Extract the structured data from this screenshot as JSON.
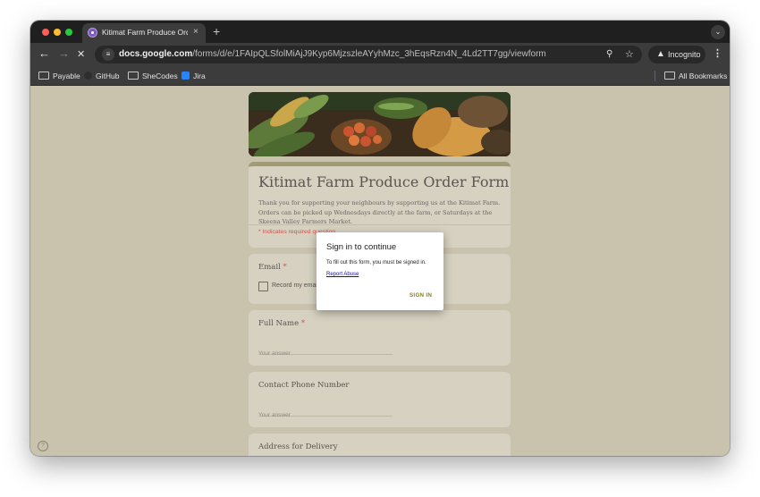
{
  "browser": {
    "tab": {
      "title": "Kitimat Farm Produce Order Form",
      "close_glyph": "×"
    },
    "new_tab_glyph": "+",
    "toolbar": {
      "back_glyph": "←",
      "forward_glyph": "→",
      "stop_glyph": "✕",
      "url_host": "docs.google.com",
      "url_path": "/forms/d/e/1FAIpQLSfolMiAjJ9Kyp6MjzszleAYyhMzc_3hEqsRzn4N_4Ld2TT7gg/viewform",
      "incognito_label": "Incognito"
    },
    "bookmarks": {
      "items": [
        "Payable",
        "GitHub",
        "SheCodes",
        "Jira"
      ],
      "all_bookmarks": "All Bookmarks"
    }
  },
  "form": {
    "title": "Kitimat Farm Produce Order Form",
    "description": "Thank you for supporting your neighbours by supporting us at the Kitimat Farm. Orders can be picked up Wednesdays directly at the farm, or Saturdays at the Skeena Valley Farmers Market.",
    "required_note": "* Indicates required question",
    "email": {
      "label": "Email",
      "required_mark": "*",
      "checkbox_label": "Record my email address with my response"
    },
    "questions": [
      {
        "label": "Full Name",
        "required_mark": "*",
        "placeholder": "Your answer"
      },
      {
        "label": "Contact Phone Number",
        "required_mark": "",
        "placeholder": "Your answer"
      },
      {
        "label": "Address for Delivery",
        "required_mark": ""
      }
    ],
    "help_glyph": "?"
  },
  "dialog": {
    "title": "Sign in to continue",
    "message": "To fill out this form, you must be signed in.",
    "report_link": "Report Abuse",
    "sign_in_button": "SIGN IN"
  },
  "colors": {
    "form_accent": "#a09b74",
    "required_red": "#c55a54",
    "sign_in_button": "#8c7c16",
    "link_blue": "#1a0dab"
  }
}
